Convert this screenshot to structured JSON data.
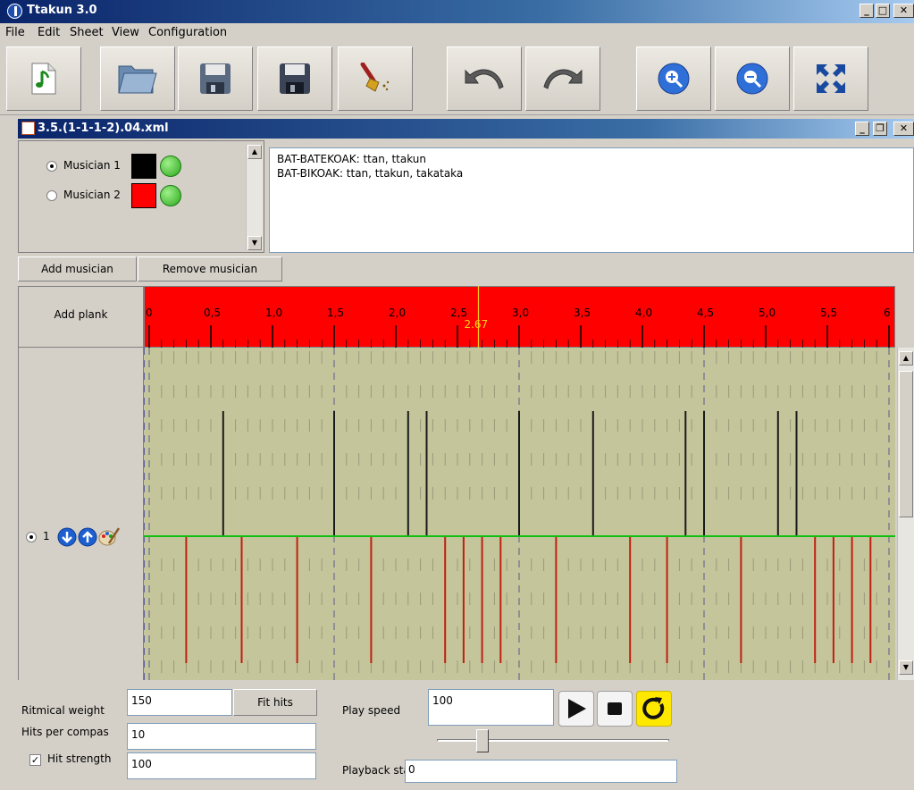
{
  "app": {
    "title": "Ttakun 3.0"
  },
  "menu": [
    "File",
    "Edit",
    "Sheet",
    "View",
    "Configuration"
  ],
  "toolbar": [
    "new-music-icon",
    "open-folder-icon",
    "save-icon",
    "save-as-icon",
    "clear-brush-icon",
    "undo-icon",
    "redo-icon",
    "zoom-in-icon",
    "zoom-out-icon",
    "fit-view-icon"
  ],
  "document": {
    "title": "3.5.(1-1-1-2).04.xml"
  },
  "musicians": [
    {
      "label": "Musician 1",
      "color": "#000000",
      "selected": true
    },
    {
      "label": "Musician 2",
      "color": "#ff0000",
      "selected": false
    }
  ],
  "notes": {
    "line1": "BAT-BATEKOAK: ttan, ttakun",
    "line2": "BAT-BIKOAK: ttan, ttakun, takataka"
  },
  "buttons": {
    "add_musician": "Add musician",
    "remove_musician": "Remove musician",
    "add_plank": "Add plank",
    "fit_hits": "Fit hits"
  },
  "ruler": {
    "ticks": [
      "0",
      "0,5",
      "1,0",
      "1,5",
      "2,0",
      "2,5",
      "3,0",
      "3,5",
      "4,0",
      "4,5",
      "5,0",
      "5,5",
      "6"
    ],
    "cursor_label": "2.67",
    "cursor_value": 2.67,
    "max": 6
  },
  "plank": {
    "number": "1",
    "black_hits": [
      0.6,
      1.5,
      2.1,
      2.25,
      3.0,
      3.6,
      4.35,
      4.5,
      5.1,
      5.25
    ],
    "red_hits": [
      0.3,
      0.75,
      1.2,
      1.8,
      2.4,
      2.55,
      2.7,
      2.85,
      3.3,
      3.9,
      4.2,
      4.8,
      5.4,
      5.55,
      5.7,
      5.85
    ]
  },
  "settings": {
    "rhythmic_weight_label": "Ritmical weight",
    "rhythmic_weight": "150",
    "hits_per_compas_label": "Hits per compas",
    "hits_per_compas": "10",
    "hit_strength_label": "Hit strength",
    "hit_strength": "100",
    "hit_strength_checked": true,
    "play_speed_label": "Play speed",
    "play_speed": "100",
    "playback_start_label": "Playback start",
    "playback_start": "0"
  }
}
